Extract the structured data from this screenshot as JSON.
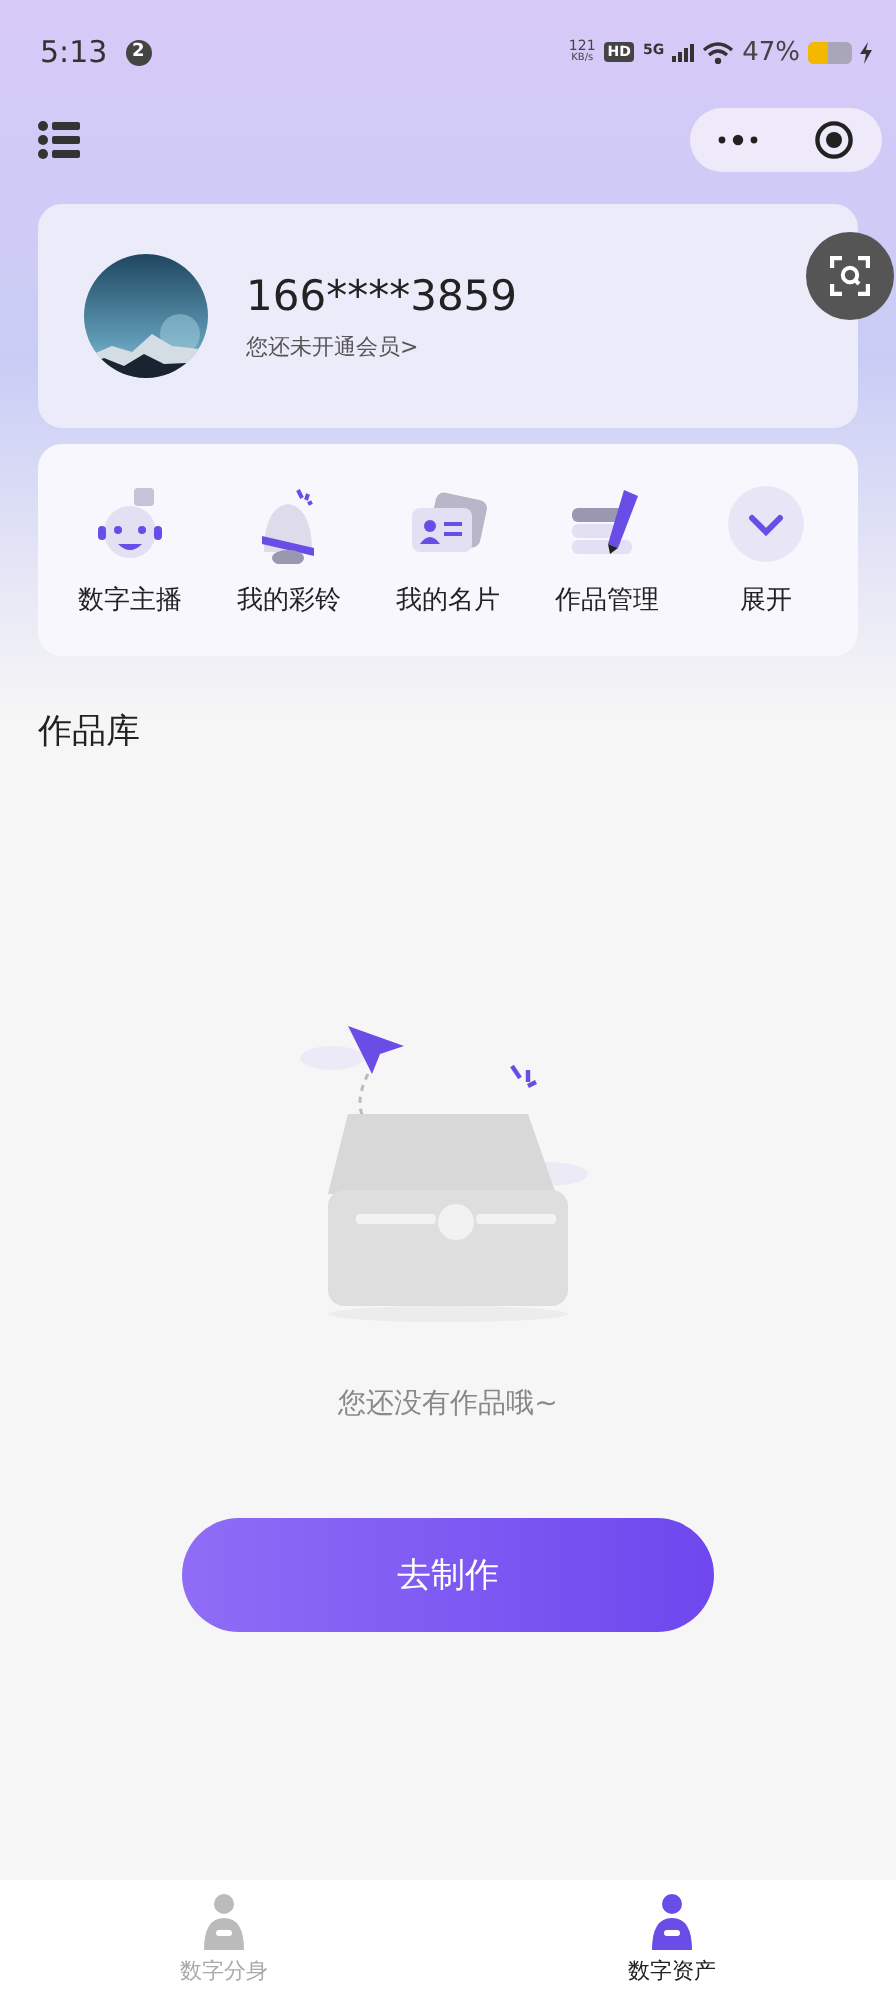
{
  "status_bar": {
    "time": "5:13",
    "badge": "2",
    "speed": "121",
    "speed_unit": "KB/s",
    "hd": "HD",
    "network": "5G",
    "battery": "47%"
  },
  "profile": {
    "phone": "166****3859",
    "membership": "您还未开通会员>"
  },
  "shortcuts": [
    {
      "kind": "robot",
      "label": "数字主播"
    },
    {
      "kind": "bell",
      "label": "我的彩铃"
    },
    {
      "kind": "card",
      "label": "我的名片"
    },
    {
      "kind": "stack",
      "label": "作品管理"
    },
    {
      "kind": "expand",
      "label": "展开"
    }
  ],
  "section_title": "作品库",
  "empty_state": {
    "message": "您还没有作品哦~",
    "button": "去制作"
  },
  "tab_bar": [
    {
      "label": "数字分身",
      "selected": false
    },
    {
      "label": "数字资产",
      "selected": true
    }
  ]
}
